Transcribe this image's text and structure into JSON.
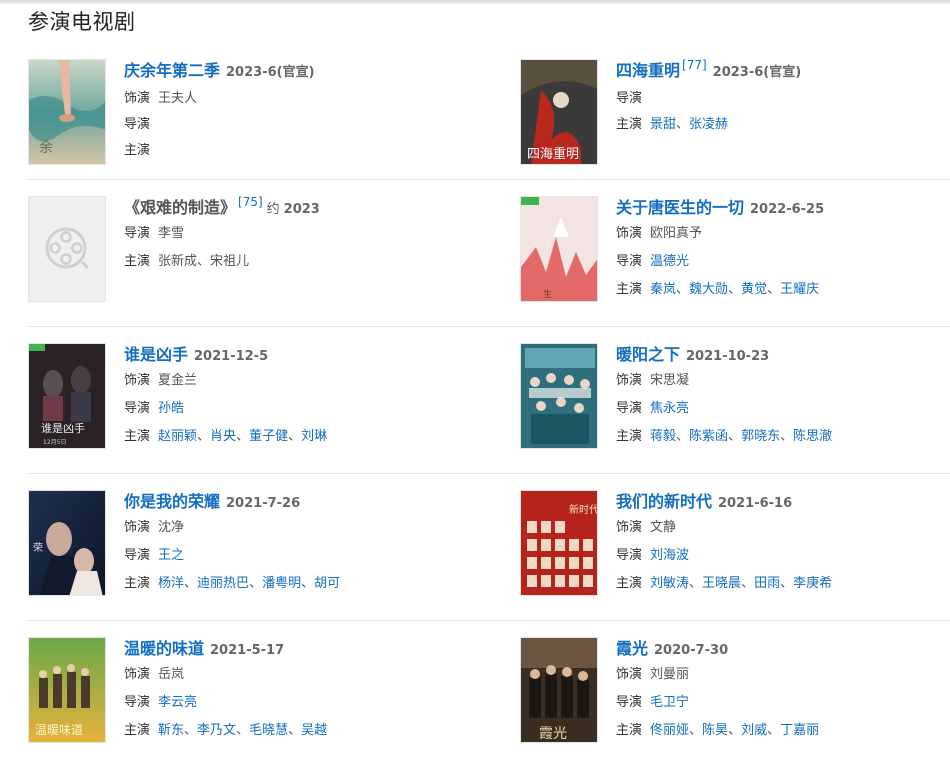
{
  "section": {
    "title": "参演电视剧"
  },
  "placeholder_icon": "film-reel-icon",
  "shows": [
    {
      "title": "庆余年第二季",
      "date": "2023-6(官宣)",
      "role_label": "饰演",
      "role": "王夫人",
      "director_label": "导演",
      "director": [],
      "stars_label": "主演",
      "stars": []
    },
    {
      "title": "四海重明",
      "sup": "[77]",
      "date": "2023-6(官宣)",
      "director_label": "导演",
      "director": [],
      "stars_label": "主演",
      "stars": [
        "景甜",
        "张凌赫"
      ]
    },
    {
      "title": "《艰难的制造》",
      "sup": "[75]",
      "prefix": "约",
      "date": "2023",
      "director_label": "导演",
      "director_plain": "李雪",
      "stars_label": "主演",
      "stars_plain": "张新成、宋祖儿"
    },
    {
      "title": "关于唐医生的一切",
      "date": "2022-6-25",
      "role_label": "饰演",
      "role": "欧阳真予",
      "director_label": "导演",
      "director": [
        "温德光"
      ],
      "stars_label": "主演",
      "stars": [
        "秦岚",
        "魏大勋",
        "黄觉",
        "王耀庆"
      ]
    },
    {
      "title": "谁是凶手",
      "date": "2021-12-5",
      "role_label": "饰演",
      "role": "夏金兰",
      "director_label": "导演",
      "director": [
        "孙皓"
      ],
      "stars_label": "主演",
      "stars": [
        "赵丽颖",
        "肖央",
        "董子健",
        "刘琳"
      ]
    },
    {
      "title": "暖阳之下",
      "date": "2021-10-23",
      "role_label": "饰演",
      "role": "宋思凝",
      "director_label": "导演",
      "director": [
        "焦永亮"
      ],
      "stars_label": "主演",
      "stars": [
        "蒋毅",
        "陈紫函",
        "郭晓东",
        "陈思澈"
      ]
    },
    {
      "title": "你是我的荣耀",
      "date": "2021-7-26",
      "role_label": "饰演",
      "role": "沈净",
      "director_label": "导演",
      "director": [
        "王之"
      ],
      "stars_label": "主演",
      "stars": [
        "杨洋",
        "迪丽热巴",
        "潘粤明",
        "胡可"
      ]
    },
    {
      "title": "我们的新时代",
      "date": "2021-6-16",
      "role_label": "饰演",
      "role": "文静",
      "director_label": "导演",
      "director": [
        "刘海波"
      ],
      "stars_label": "主演",
      "stars": [
        "刘敏涛",
        "王晓晨",
        "田雨",
        "李庚希"
      ]
    },
    {
      "title": "温暖的味道",
      "date": "2021-5-17",
      "role_label": "饰演",
      "role": "岳岚",
      "director_label": "导演",
      "director": [
        "李云亮"
      ],
      "stars_label": "主演",
      "stars": [
        "靳东",
        "李乃文",
        "毛晓慧",
        "吴越"
      ]
    },
    {
      "title": "霞光",
      "date": "2020-7-30",
      "role_label": "饰演",
      "role": "刘曼丽",
      "director_label": "导演",
      "director": [
        "毛卫宁"
      ],
      "stars_label": "主演",
      "stars": [
        "佟丽娅",
        "陈昊",
        "刘威",
        "丁嘉丽"
      ]
    }
  ],
  "separator": "、"
}
